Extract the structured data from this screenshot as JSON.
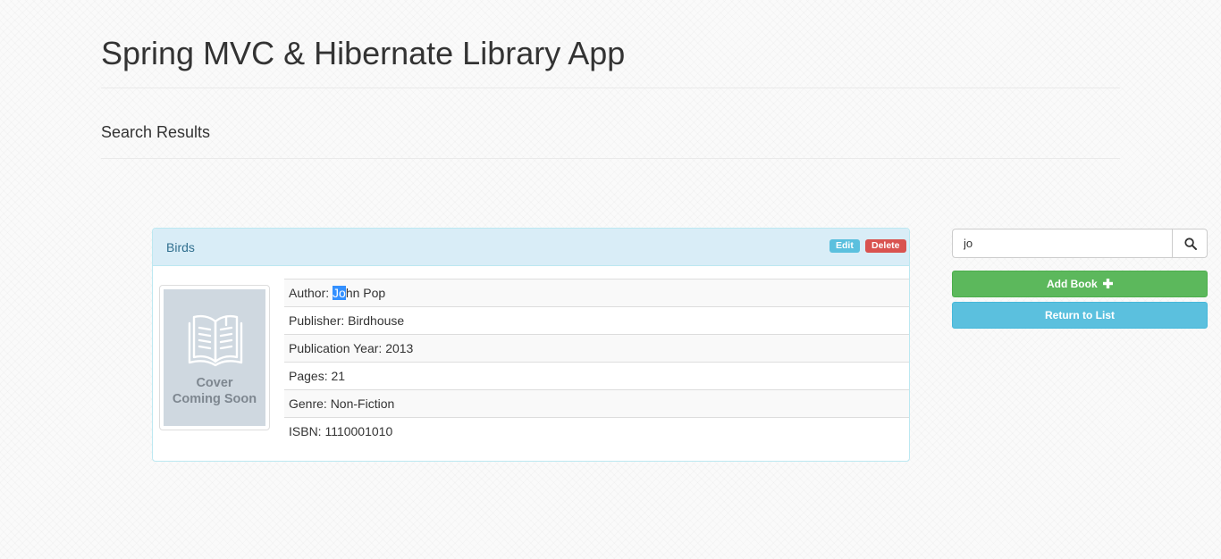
{
  "app": {
    "title": "Spring MVC & Hibernate Library App"
  },
  "page": {
    "section_title": "Search Results"
  },
  "book": {
    "title": "Birds",
    "edit_label": "Edit",
    "delete_label": "Delete",
    "cover_placeholder": "Cover\nComing Soon",
    "author_label": "Author: ",
    "author_highlight": "Jo",
    "author_rest": "hn Pop",
    "publisher": "Publisher: Birdhouse",
    "publication_year": "Publication Year: 2013",
    "pages": "Pages: 21",
    "genre": "Genre: Non-Fiction",
    "isbn": "ISBN: 1110001010"
  },
  "sidebar": {
    "search_value": "jo",
    "search_icon": "search-icon",
    "add_book_label": "Add Book",
    "add_book_icon": "plus-icon",
    "return_label": "Return to List"
  },
  "colors": {
    "panel_header": "#d9edf7",
    "title_link": "#31708f",
    "edit": "#5bc0de",
    "delete": "#d9534f",
    "add_book": "#5cb85c",
    "return": "#5bc0de"
  }
}
